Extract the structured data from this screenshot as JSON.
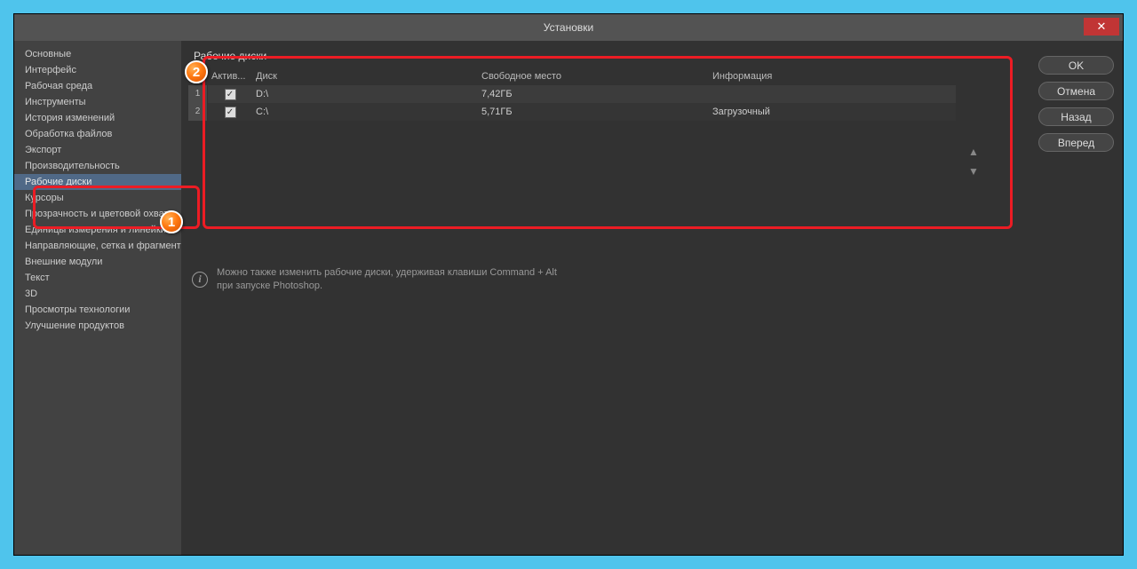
{
  "window": {
    "title": "Установки",
    "close": "✕"
  },
  "sidebar": {
    "items": [
      "Основные",
      "Интерфейс",
      "Рабочая среда",
      "Инструменты",
      "История изменений",
      "Обработка файлов",
      "Экспорт",
      "Производительность",
      "Рабочие диски",
      "Курсоры",
      "Прозрачность и цветовой охват",
      "Единицы измерения и линейки",
      "Направляющие, сетка и фрагменты",
      "Внешние модули",
      "Текст",
      "3D",
      "Просмотры технологии",
      "Улучшение продуктов"
    ],
    "selected_idx": 8
  },
  "buttons": {
    "ok": "OK",
    "cancel": "Отмена",
    "prev": "Назад",
    "next": "Вперед"
  },
  "section": {
    "title": "Рабочие диски",
    "headers": {
      "active": "Актив...",
      "disk": "Диск",
      "free": "Свободное место",
      "info": "Информация"
    },
    "rows": [
      {
        "num": "1",
        "checked": true,
        "disk": "D:\\",
        "free": "7,42ГБ",
        "info": ""
      },
      {
        "num": "2",
        "checked": true,
        "disk": "C:\\",
        "free": "5,71ГБ",
        "info": "Загрузочный"
      }
    ],
    "arrows": {
      "up": "▲",
      "down": "▼"
    }
  },
  "info": {
    "line1": "Можно также изменить рабочие диски, удерживая клавиши Command + Alt",
    "line2": "при запуске Photoshop."
  },
  "badges": {
    "one": "1",
    "two": "2"
  }
}
